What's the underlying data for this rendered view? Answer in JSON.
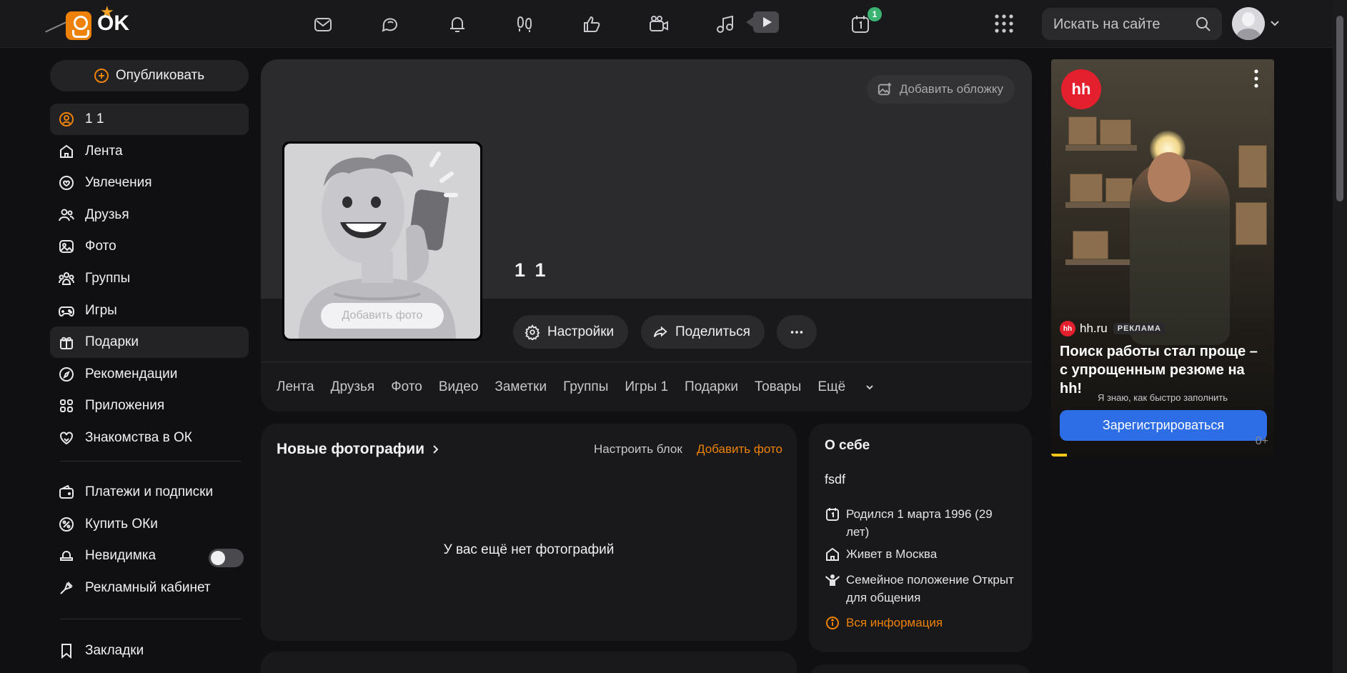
{
  "brand": {
    "logo_text": "OK"
  },
  "topbar": {
    "icons": [
      "mail-icon",
      "chat-icon",
      "bell-icon",
      "guests-icon",
      "likes-icon",
      "video-camera-icon",
      "music-icon",
      "video-play-icon",
      "calendar-icon"
    ],
    "calendar_badge": "1",
    "search_placeholder": "Искать на сайте"
  },
  "sidebar": {
    "publish_label": "Опубликовать",
    "items": [
      {
        "label": "1 1",
        "icon": "profile-icon"
      },
      {
        "label": "Лента",
        "icon": "home-icon"
      },
      {
        "label": "Увлечения",
        "icon": "hobby-icon"
      },
      {
        "label": "Друзья",
        "icon": "friends-icon"
      },
      {
        "label": "Фото",
        "icon": "photo-icon"
      },
      {
        "label": "Группы",
        "icon": "groups-icon"
      },
      {
        "label": "Игры",
        "icon": "gamepad-icon"
      },
      {
        "label": "Подарки",
        "icon": "gift-icon"
      },
      {
        "label": "Рекомендации",
        "icon": "compass-icon"
      },
      {
        "label": "Приложения",
        "icon": "apps-icon"
      },
      {
        "label": "Знакомства в ОК",
        "icon": "dating-icon"
      }
    ],
    "items2": [
      {
        "label": "Платежи и подписки",
        "icon": "wallet-icon"
      },
      {
        "label": "Купить ОКи",
        "icon": "coin-icon"
      },
      {
        "label": "Невидимка",
        "icon": "invisible-icon"
      },
      {
        "label": "Рекламный кабинет",
        "icon": "ad-cabinet-icon"
      }
    ],
    "bookmarks_label": "Закладки"
  },
  "profile": {
    "cover_button": "Добавить обложку",
    "add_photo": "Добавить фото",
    "name": "1 1",
    "settings": "Настройки",
    "share": "Поделиться",
    "tabs": [
      "Лента",
      "Друзья",
      "Фото",
      "Видео",
      "Заметки",
      "Группы",
      "Игры 1",
      "Подарки",
      "Товары"
    ],
    "tab_more": "Ещё"
  },
  "photos_block": {
    "title": "Новые фотографии",
    "setup": "Настроить блок",
    "add": "Добавить фото",
    "empty": "У вас ещё нет фотографий"
  },
  "about": {
    "title": "О себе",
    "text": "fsdf",
    "born": "Родился 1 марта 1996 (29 лет)",
    "lives": "Живет в Москва",
    "family": "Семейное положение Открыт для общения",
    "all_info": "Вся информация"
  },
  "ad": {
    "logo": "hh",
    "brand": "hh.ru",
    "label": "РЕКЛАМА",
    "headline": "Поиск работы стал проще – с упрощенным резюме на hh!",
    "subtext": "Я знаю, как быстро заполнить склад",
    "cta": "Зарегистрироваться",
    "age": "0+"
  },
  "colors": {
    "accent": "#ee8208",
    "background": "#101012",
    "card": "#19191b",
    "cta": "#2d6de6"
  }
}
